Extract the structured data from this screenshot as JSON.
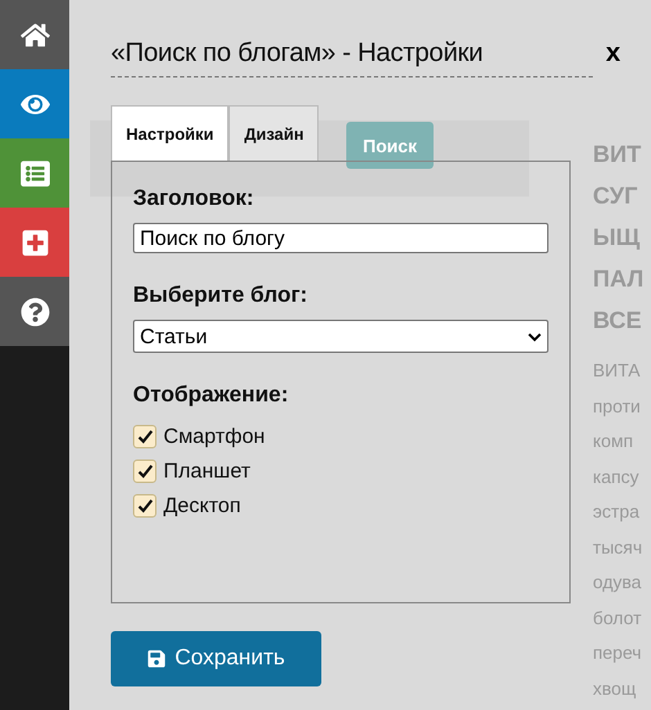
{
  "background_page": {
    "search_button": "Поиск",
    "heading_lines": [
      "ВИТ",
      "СУГ",
      "ЫЩ",
      "ПАЛ",
      "ВСЕ"
    ],
    "text_lines": [
      "ВИТА",
      "проти",
      "комп",
      "капсу",
      "эстра",
      "тысяч",
      "одува",
      "болот",
      "переч",
      "хвощ"
    ]
  },
  "dialog": {
    "title": "«Поиск по блогам» - Настройки",
    "close": "x",
    "tabs": [
      {
        "label": "Настройки",
        "selected": true
      },
      {
        "label": "Дизайн",
        "selected": false
      }
    ],
    "fields": [
      {
        "kind": "text",
        "label": "Заголовок:",
        "value": "Поиск по блогу"
      },
      {
        "kind": "select",
        "label": "Выберите блог:",
        "value": "Статьи"
      }
    ],
    "display": {
      "label": "Отображение:",
      "options": [
        {
          "label": "Смартфон",
          "checked": true
        },
        {
          "label": "Планшет",
          "checked": true
        },
        {
          "label": "Десктоп",
          "checked": true
        }
      ]
    },
    "save_button": "Сохранить"
  }
}
